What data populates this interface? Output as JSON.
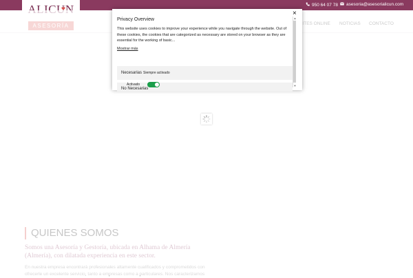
{
  "header": {
    "logo": {
      "name": "ALICUN",
      "tagline": "ASESORÍA"
    },
    "phone": "950 64 07 78",
    "email": "asesoria@asesorialicun.com"
  },
  "nav": {
    "items": [
      {
        "label": "MITES ONLINE"
      },
      {
        "label": "NOTICIAS"
      },
      {
        "label": "CONTACTO"
      }
    ]
  },
  "main": {
    "heading": "QUIENES SOMOS",
    "lead": "Somos una Asesoría y Gestoría, ubicada en Alhama de Almería (Almería), con dilatada experiencia en este sector.",
    "paragraph": "En nuestra empresa encontrará profesionales altamente cualificados y comprometidos con ofrecerle un excelente servicio, tanto a empresas como a particulares. Nos caracterizamos"
  },
  "cookie_modal": {
    "title": "Privacy Overview",
    "body": "This website uses cookies to improve your experience while you navigate through the website. Out of these cookies, the cookies that are categorized as necessary are stored on your browser as they are essential for the working of basic...",
    "show_more": "Mostrar más",
    "close_symbol": "×",
    "necessary": {
      "label": "Necesarias",
      "status": "Siempre activado"
    },
    "not_necessary": {
      "label": "No Necesarias",
      "status": "Activado",
      "enabled": true
    }
  },
  "colors": {
    "brand": "#8a3a5f",
    "accent": "#e2716d",
    "toggle_on": "#1a9e4a"
  },
  "icons": [
    "phone-icon",
    "envelope-icon",
    "close-icon",
    "loading-spinner-icon",
    "heart-icon"
  ]
}
